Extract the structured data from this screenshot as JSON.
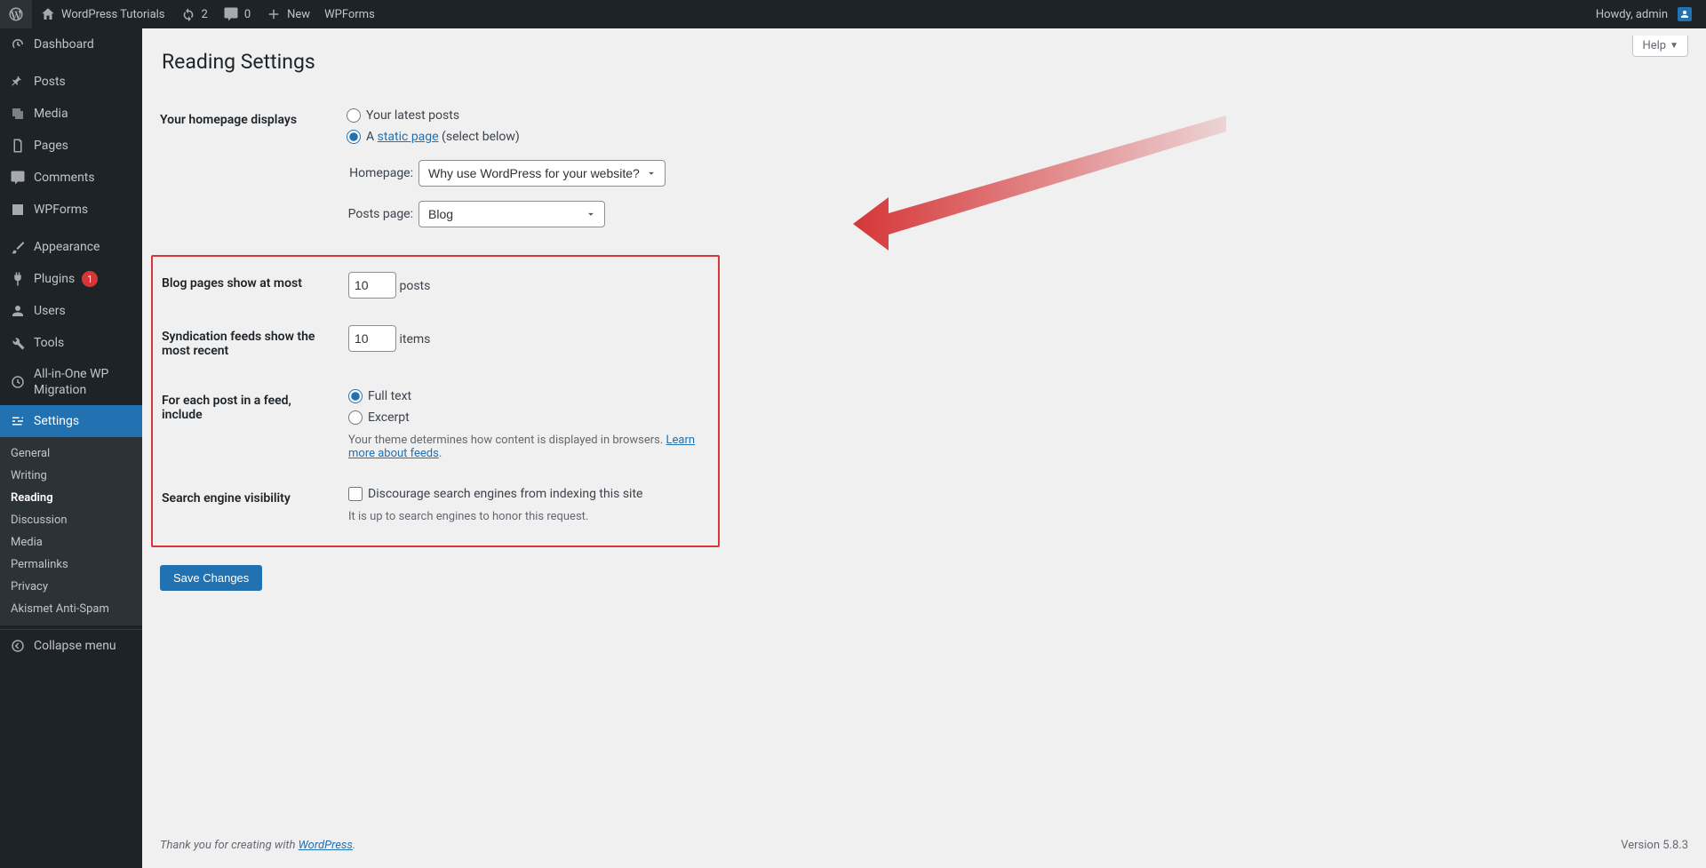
{
  "adminbar": {
    "site_title": "WordPress Tutorials",
    "updates_count": "2",
    "comments_count": "0",
    "new_label": "New",
    "wpforms_label": "WPForms",
    "howdy": "Howdy, admin"
  },
  "sidebar": {
    "dashboard": "Dashboard",
    "posts": "Posts",
    "media": "Media",
    "pages": "Pages",
    "comments": "Comments",
    "wpforms": "WPForms",
    "appearance": "Appearance",
    "plugins": "Plugins",
    "plugins_badge": "1",
    "users": "Users",
    "tools": "Tools",
    "aio": "All-in-One WP Migration",
    "settings": "Settings",
    "sub": {
      "general": "General",
      "writing": "Writing",
      "reading": "Reading",
      "discussion": "Discussion",
      "media": "Media",
      "permalinks": "Permalinks",
      "privacy": "Privacy",
      "akismet": "Akismet Anti-Spam"
    },
    "collapse": "Collapse menu"
  },
  "page": {
    "help": "Help",
    "title": "Reading Settings",
    "homepage_displays_label": "Your homepage displays",
    "radio_latest": "Your latest posts",
    "radio_static_prefix": "A ",
    "radio_static_link": "static page",
    "radio_static_suffix": " (select below)",
    "homepage_label": "Homepage:",
    "homepage_value": "Why use WordPress for your website?",
    "posts_page_label": "Posts page:",
    "posts_page_value": "Blog",
    "blog_pages_label": "Blog pages show at most",
    "blog_pages_value": "10",
    "blog_pages_unit": "posts",
    "syndication_label": "Syndication feeds show the most recent",
    "syndication_value": "10",
    "syndication_unit": "items",
    "feed_include_label": "For each post in a feed, include",
    "feed_full": "Full text",
    "feed_excerpt": "Excerpt",
    "feed_desc_prefix": "Your theme determines how content is displayed in browsers. ",
    "feed_desc_link": "Learn more about feeds",
    "sev_label": "Search engine visibility",
    "sev_checkbox": "Discourage search engines from indexing this site",
    "sev_desc": "It is up to search engines to honor this request.",
    "save": "Save Changes",
    "footer_thanks": "Thank you for creating with ",
    "footer_wp": "WordPress",
    "version": "Version 5.8.3"
  }
}
